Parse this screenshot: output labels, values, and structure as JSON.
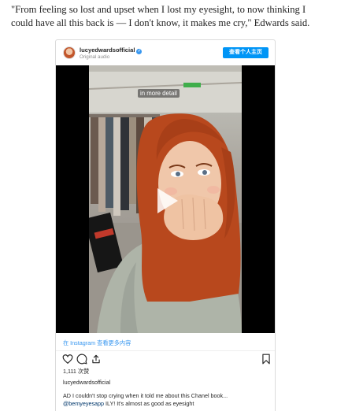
{
  "article": {
    "quote": "\"From feeling so lost and upset when I lost my eyesight, to now thinking I could have all this back is — I don't know, it makes me cry,\" Edwards said."
  },
  "embed": {
    "username": "lucyedwardsofficial",
    "verified_mark": "✓",
    "subtitle": "Original audio",
    "profile_button": "查看个人主页",
    "video_caption": "in more detail",
    "instagram_link": "在 Instagram 查看更多内容",
    "likes": "1,111 次赞",
    "owner": "lucyedwardsofficial",
    "caption_line1": "AD I couldn't stop crying when it told me about this Chanel book...",
    "caption_tag": "@bemyeyesapp",
    "caption_line2_rest": " ILY! It's almost as good as eyesight"
  },
  "colors": {
    "accent": "#0095f6",
    "link": "#3897f0",
    "hair": "#b8481d",
    "coat": "#aeb4a8"
  }
}
